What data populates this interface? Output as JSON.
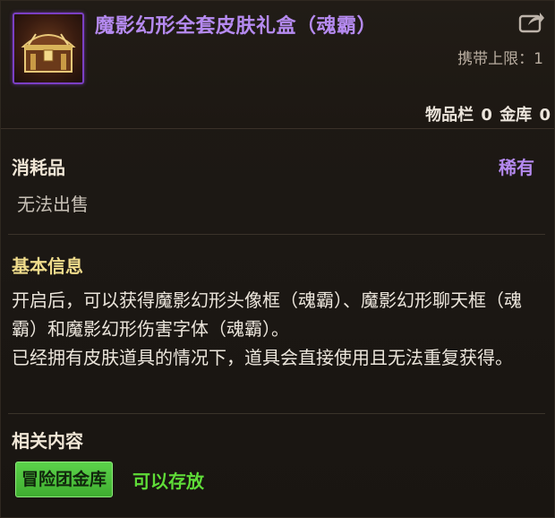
{
  "item": {
    "title": "魔影幻形全套皮肤礼盒（魂霸）",
    "icon": "treasure-chest-icon",
    "carry_limit": "携带上限：1",
    "storage": {
      "inventory_label": "物品栏",
      "inventory_count": "0",
      "bank_label": "金库",
      "bank_count": "0"
    }
  },
  "type": {
    "category": "消耗品",
    "rarity": "稀有",
    "sell_status": "无法出售"
  },
  "basic_info": {
    "heading": "基本信息",
    "lines": [
      "开启后，可以获得魔影幻形头像框（魂霸）、魔影幻形聊天框（魂霸）和魔影幻形伤害字体（魂霸）。",
      "已经拥有皮肤道具的情况下，道具会直接使用且无法重复获得。"
    ]
  },
  "related": {
    "heading": "相关内容",
    "bank_button": "冒险团金库",
    "bank_status": "可以存放"
  },
  "colors": {
    "title": "#b58af0",
    "rarity": "#b58af0",
    "heading": "#f0dc8c",
    "store_ok": "#5fdc38"
  }
}
